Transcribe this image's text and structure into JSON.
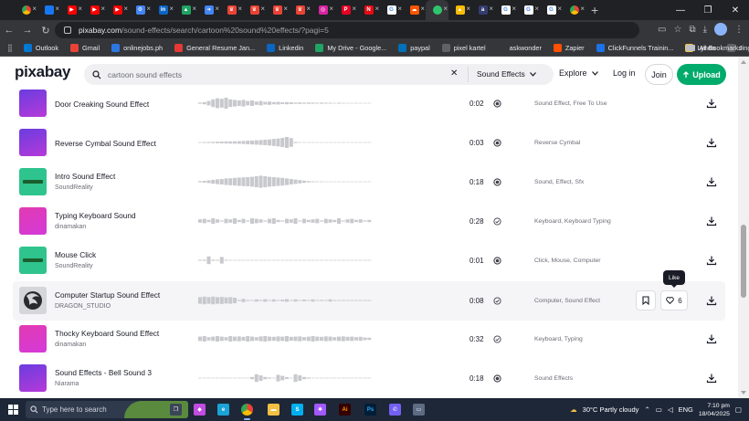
{
  "browser": {
    "tabs": [
      {
        "icon": "chrome-icon",
        "color": "#dddddd",
        "glyph": ""
      },
      {
        "icon": "messenger-icon",
        "color": "#1877f2",
        "glyph": ""
      },
      {
        "icon": "youtube-icon",
        "color": "#ff0000",
        "glyph": "▶"
      },
      {
        "icon": "youtube-icon",
        "color": "#ff0000",
        "glyph": "▶"
      },
      {
        "icon": "youtube-icon",
        "color": "#ff0000",
        "glyph": "▶"
      },
      {
        "icon": "settings-icon",
        "color": "#4285f4",
        "glyph": "⚙"
      },
      {
        "icon": "linkedin-icon",
        "color": "#0a66c2",
        "glyph": "in"
      },
      {
        "icon": "drive-icon",
        "color": "#1fa463",
        "glyph": "▲"
      },
      {
        "icon": "arrow-icon",
        "color": "#4285f4",
        "glyph": "➜"
      },
      {
        "icon": "brand-icon",
        "color": "#ea4335",
        "glyph": "♛"
      },
      {
        "icon": "brand-icon",
        "color": "#ea4335",
        "glyph": "♛"
      },
      {
        "icon": "brand-icon",
        "color": "#ea4335",
        "glyph": "♛"
      },
      {
        "icon": "brand-icon",
        "color": "#ea4335",
        "glyph": "♛"
      },
      {
        "icon": "instagram-icon",
        "color": "#d6249f",
        "glyph": "◎"
      },
      {
        "icon": "pinterest-icon",
        "color": "#e60023",
        "glyph": "P"
      },
      {
        "icon": "netflix-icon",
        "color": "#e50914",
        "glyph": "N"
      },
      {
        "icon": "google-icon",
        "color": "#ffffff",
        "glyph": "G"
      },
      {
        "icon": "soundcloud-icon",
        "color": "#ff5500",
        "glyph": "☁"
      },
      {
        "icon": "pixabay-icon",
        "color": "#2ec66d",
        "glyph": "",
        "active": true
      },
      {
        "icon": "drive-icon",
        "color": "#fbbc04",
        "glyph": "▲"
      },
      {
        "icon": "ask-icon",
        "color": "#333c6e",
        "glyph": "a"
      },
      {
        "icon": "google-icon",
        "color": "#ffffff",
        "glyph": "G"
      },
      {
        "icon": "google-icon",
        "color": "#ffffff",
        "glyph": "G"
      },
      {
        "icon": "google-icon",
        "color": "#ffffff",
        "glyph": "G"
      },
      {
        "icon": "chrome-icon",
        "color": "#dddddd",
        "glyph": ""
      }
    ],
    "address": {
      "host": "pixabay.com",
      "path": "/sound-effects/search/cartoon%20sound%20effects/?pagi=5"
    },
    "bookmarks": [
      {
        "label": "Outlook",
        "color": "#0078d4"
      },
      {
        "label": "Gmail",
        "color": "#ea4335"
      },
      {
        "label": "onlinejobs.ph",
        "color": "#2b78e4"
      },
      {
        "label": "General Resume Jan...",
        "color": "#e53935"
      },
      {
        "label": "Linkedin",
        "color": "#0a66c2"
      },
      {
        "label": "My Drive - Google...",
        "color": "#1fa463"
      },
      {
        "label": "paypal",
        "color": "#0070ba"
      },
      {
        "label": "pixel kartel",
        "color": "#5f6368"
      },
      {
        "label": "askwonder",
        "color": "#35363a"
      },
      {
        "label": "Zapier",
        "color": "#ff4f00"
      },
      {
        "label": "ClickFunnels Trainin...",
        "color": "#1a73e8"
      },
      {
        "label": "Lynda",
        "color": "#f6c244"
      },
      {
        "label": "Jing",
        "color": "#5f6368"
      }
    ],
    "all_bookmarks": "All Bookmarks"
  },
  "header": {
    "logo": "pixabay",
    "search_value": "cartoon sound effects",
    "search_type": "Sound Effects",
    "explore": "Explore",
    "login": "Log in",
    "join": "Join",
    "upload": "Upload"
  },
  "results": [
    {
      "title": "Door Creaking Sound Effect",
      "author": "",
      "duration": "0:02",
      "tags": "Sound Effect, Free To Use",
      "thumb": "purple",
      "badge": "filled",
      "wave": [
        0.05,
        0.1,
        0.2,
        0.35,
        0.45,
        0.4,
        0.5,
        0.35,
        0.3,
        0.25,
        0.3,
        0.2,
        0.25,
        0.15,
        0.2,
        0.12,
        0.15,
        0.1,
        0.12,
        0.08,
        0.1,
        0.08,
        0.06,
        0.07,
        0.05,
        0.06,
        0.05,
        0.04,
        0.05,
        0.04,
        0.04,
        0.03,
        0.04,
        0.03,
        0.03,
        0.03,
        0.03,
        0.02,
        0.02,
        0.02
      ]
    },
    {
      "title": "Reverse Cymbal Sound Effect",
      "author": "",
      "duration": "0:03",
      "tags": "Reverse Cymbal",
      "thumb": "purple",
      "badge": "filled",
      "wave": [
        0.03,
        0.04,
        0.05,
        0.06,
        0.07,
        0.08,
        0.09,
        0.1,
        0.11,
        0.12,
        0.14,
        0.16,
        0.18,
        0.2,
        0.22,
        0.25,
        0.28,
        0.32,
        0.36,
        0.42,
        0.5,
        0.4,
        0.05,
        0.03,
        0.02,
        0.02,
        0.02,
        0.02,
        0.02,
        0.02,
        0.02,
        0.02,
        0.02,
        0.02,
        0.02,
        0.02,
        0.02,
        0.02,
        0.02,
        0.02
      ]
    },
    {
      "title": "Intro Sound Effect",
      "author": "SoundReality",
      "duration": "0:18",
      "tags": "Sound, Effect, Sfx",
      "thumb": "green",
      "badge": "filled",
      "wave": [
        0.05,
        0.08,
        0.12,
        0.18,
        0.22,
        0.25,
        0.3,
        0.32,
        0.35,
        0.38,
        0.4,
        0.42,
        0.45,
        0.5,
        0.55,
        0.5,
        0.45,
        0.42,
        0.38,
        0.35,
        0.3,
        0.25,
        0.2,
        0.15,
        0.1,
        0.06,
        0.04,
        0.03,
        0.03,
        0.02,
        0.02,
        0.02,
        0.02,
        0.02,
        0.02,
        0.02,
        0.02,
        0.02,
        0.02,
        0.02
      ]
    },
    {
      "title": "Typing Keyboard Sound",
      "author": "dinamakan",
      "duration": "0:28",
      "tags": "Keyboard, Keyboard Typing",
      "thumb": "pink",
      "badge": "check",
      "wave": [
        0.15,
        0.2,
        0.1,
        0.25,
        0.15,
        0.05,
        0.2,
        0.15,
        0.25,
        0.1,
        0.2,
        0.05,
        0.25,
        0.2,
        0.15,
        0.05,
        0.2,
        0.25,
        0.1,
        0.05,
        0.2,
        0.15,
        0.25,
        0.05,
        0.2,
        0.1,
        0.15,
        0.2,
        0.05,
        0.2,
        0.15,
        0.1,
        0.25,
        0.05,
        0.15,
        0.2,
        0.1,
        0.15,
        0.05,
        0.1
      ]
    },
    {
      "title": "Mouse Click",
      "author": "SoundReality",
      "duration": "0:01",
      "tags": "Click, Mouse, Computer",
      "thumb": "green",
      "badge": "filled",
      "wave": [
        0.04,
        0.05,
        0.35,
        0.05,
        0.04,
        0.3,
        0.04,
        0.03,
        0.03,
        0.03,
        0.03,
        0.03,
        0.03,
        0.03,
        0.03,
        0.03,
        0.03,
        0.03,
        0.03,
        0.03,
        0.03,
        0.03,
        0.03,
        0.03,
        0.03,
        0.03,
        0.03,
        0.03,
        0.03,
        0.03,
        0.03,
        0.03,
        0.03,
        0.03,
        0.03,
        0.03,
        0.03,
        0.03,
        0.03,
        0.03
      ]
    },
    {
      "title": "Computer Startup Sound Effect",
      "author": "DRAGON_STUDIO",
      "duration": "0:08",
      "tags": "Computer, Sound Effect",
      "thumb": "dragon",
      "badge": "check",
      "hover": true,
      "likes": "6",
      "wave": [
        0.3,
        0.35,
        0.3,
        0.35,
        0.3,
        0.32,
        0.28,
        0.3,
        0.25,
        0.05,
        0.15,
        0.05,
        0.04,
        0.1,
        0.05,
        0.12,
        0.04,
        0.1,
        0.04,
        0.08,
        0.12,
        0.04,
        0.1,
        0.04,
        0.08,
        0.04,
        0.1,
        0.04,
        0.05,
        0.04,
        0.1,
        0.04,
        0.04,
        0.04,
        0.04,
        0.04,
        0.04,
        0.04,
        0.04,
        0.04
      ]
    },
    {
      "title": "Thocky Keyboard Sound Effect",
      "author": "dinamakan",
      "duration": "0:32",
      "tags": "Keyboard, Typing",
      "thumb": "pink",
      "badge": "check",
      "wave": [
        0.2,
        0.25,
        0.15,
        0.2,
        0.25,
        0.2,
        0.15,
        0.25,
        0.2,
        0.22,
        0.18,
        0.25,
        0.2,
        0.15,
        0.22,
        0.25,
        0.2,
        0.18,
        0.22,
        0.2,
        0.25,
        0.18,
        0.2,
        0.22,
        0.15,
        0.2,
        0.25,
        0.2,
        0.18,
        0.22,
        0.2,
        0.15,
        0.2,
        0.22,
        0.18,
        0.2,
        0.15,
        0.18,
        0.12,
        0.1
      ]
    },
    {
      "title": "Sound Effects - Bell Sound 3",
      "author": "Niarama",
      "duration": "0:18",
      "tags": "Sound Effects",
      "thumb": "purple",
      "badge": "filled",
      "wave": [
        0.03,
        0.03,
        0.03,
        0.03,
        0.03,
        0.03,
        0.03,
        0.03,
        0.03,
        0.03,
        0.03,
        0.03,
        0.1,
        0.35,
        0.25,
        0.1,
        0.05,
        0.03,
        0.3,
        0.2,
        0.08,
        0.03,
        0.35,
        0.25,
        0.1,
        0.05,
        0.03,
        0.03,
        0.03,
        0.03,
        0.03,
        0.03,
        0.03,
        0.03,
        0.03,
        0.03,
        0.03,
        0.03,
        0.03,
        0.03
      ]
    }
  ],
  "tooltip": "Like",
  "taskbar": {
    "search_placeholder": "Type here to search",
    "apps": [
      {
        "icon": "task-view-icon",
        "color": "#3b4558",
        "glyph": "❐"
      },
      {
        "icon": "copilot-icon",
        "color": "#c04de0",
        "glyph": "◆"
      },
      {
        "icon": "edge-icon",
        "color": "#1aa3d6",
        "glyph": "e"
      },
      {
        "icon": "chrome-icon",
        "color": "#dddddd",
        "glyph": "",
        "active": true
      },
      {
        "icon": "explorer-icon",
        "color": "#f4c042",
        "glyph": "▬"
      },
      {
        "icon": "skype-icon",
        "color": "#00aff0",
        "glyph": "S"
      },
      {
        "icon": "figma-icon",
        "color": "#a259ff",
        "glyph": "✱"
      },
      {
        "icon": "illustrator-icon",
        "color": "#330000",
        "glyph": "Ai"
      },
      {
        "icon": "photoshop-icon",
        "color": "#001e36",
        "glyph": "Ps"
      },
      {
        "icon": "viber-icon",
        "color": "#7360f2",
        "glyph": "✆"
      },
      {
        "icon": "photos-icon",
        "color": "#5d6b83",
        "glyph": "▭"
      }
    ],
    "weather": "30°C  Partly cloudy",
    "lang": "ENG",
    "time": "7:10 pm",
    "date": "18/04/2025"
  }
}
